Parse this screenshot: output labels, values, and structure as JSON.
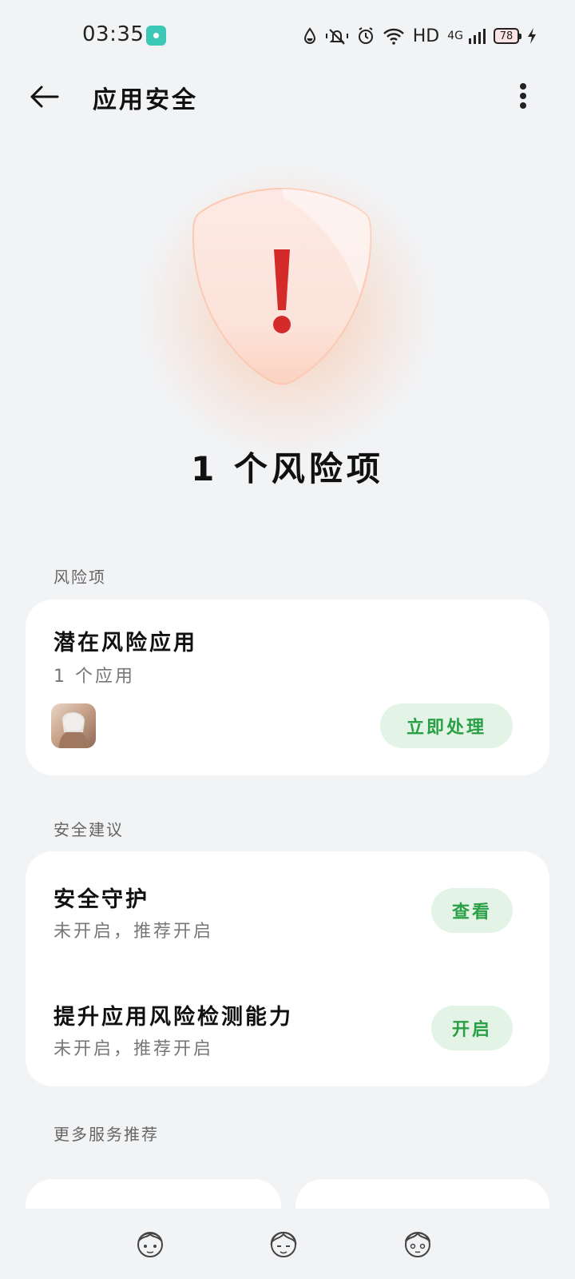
{
  "status_bar": {
    "time": "03:35",
    "network_hd": "HD",
    "network_type": "4G",
    "battery_level": "78",
    "icons": [
      "music-app-icon",
      "data-saver-icon",
      "mute-icon",
      "alarm-icon",
      "wifi-icon",
      "signal-icon",
      "battery-icon",
      "charging-icon"
    ]
  },
  "header": {
    "title": "应用安全",
    "icons": [
      "back-arrow-icon",
      "more-vert-icon"
    ]
  },
  "hero": {
    "risk_summary": "1 个风险项",
    "icon": "shield-warning-icon",
    "colors": {
      "glow": "#ff9a5f",
      "exclamation": "#d42a2a"
    }
  },
  "risk_section": {
    "label": "风险项",
    "card": {
      "title": "潜在风险应用",
      "subtitle": "1 个应用",
      "app_icon": "app-avatar-icon",
      "action_label": "立即处理"
    }
  },
  "advice_section": {
    "label": "安全建议",
    "items": [
      {
        "title": "安全守护",
        "subtitle": "未开启，推荐开启",
        "action_label": "查看"
      },
      {
        "title": "提升应用风险检测能力",
        "subtitle": "未开启，推荐开启",
        "action_label": "开启"
      }
    ]
  },
  "more_section": {
    "label": "更多服务推荐"
  },
  "bottom_nav": {
    "icons": [
      "nav-icon-1",
      "nav-icon-2",
      "nav-icon-3"
    ]
  },
  "colors": {
    "background": "#f2f3f5",
    "card": "#ffffff",
    "accent_green": "#2aa046",
    "pill_bg": "#e3f3e6"
  }
}
